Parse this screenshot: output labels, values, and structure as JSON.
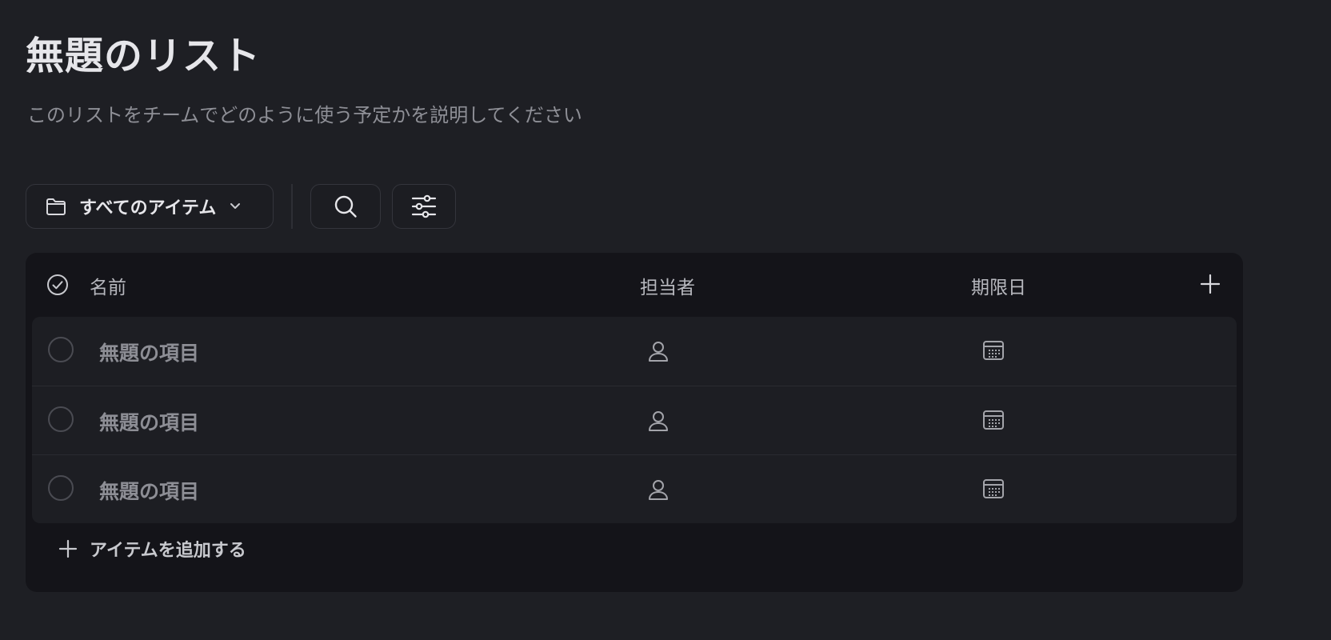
{
  "header": {
    "title": "無題のリスト",
    "description": "このリストをチームでどのように使う予定かを説明してください"
  },
  "toolbar": {
    "view_label": "すべてのアイテム",
    "view_icon": "folder-icon",
    "search_icon": "search-icon",
    "filter_icon": "sliders-icon"
  },
  "table": {
    "columns": {
      "name": "名前",
      "assignee": "担当者",
      "due_date": "期限日"
    },
    "rows": [
      {
        "name": "無題の項目"
      },
      {
        "name": "無題の項目"
      },
      {
        "name": "無題の項目"
      }
    ],
    "add_item_label": "アイテムを追加する"
  },
  "colors": {
    "background": "#1e1f24",
    "table_background": "#141419",
    "rows_background": "#1d1e23",
    "text_primary": "#e6e6ea",
    "text_muted": "#8e8f96"
  }
}
